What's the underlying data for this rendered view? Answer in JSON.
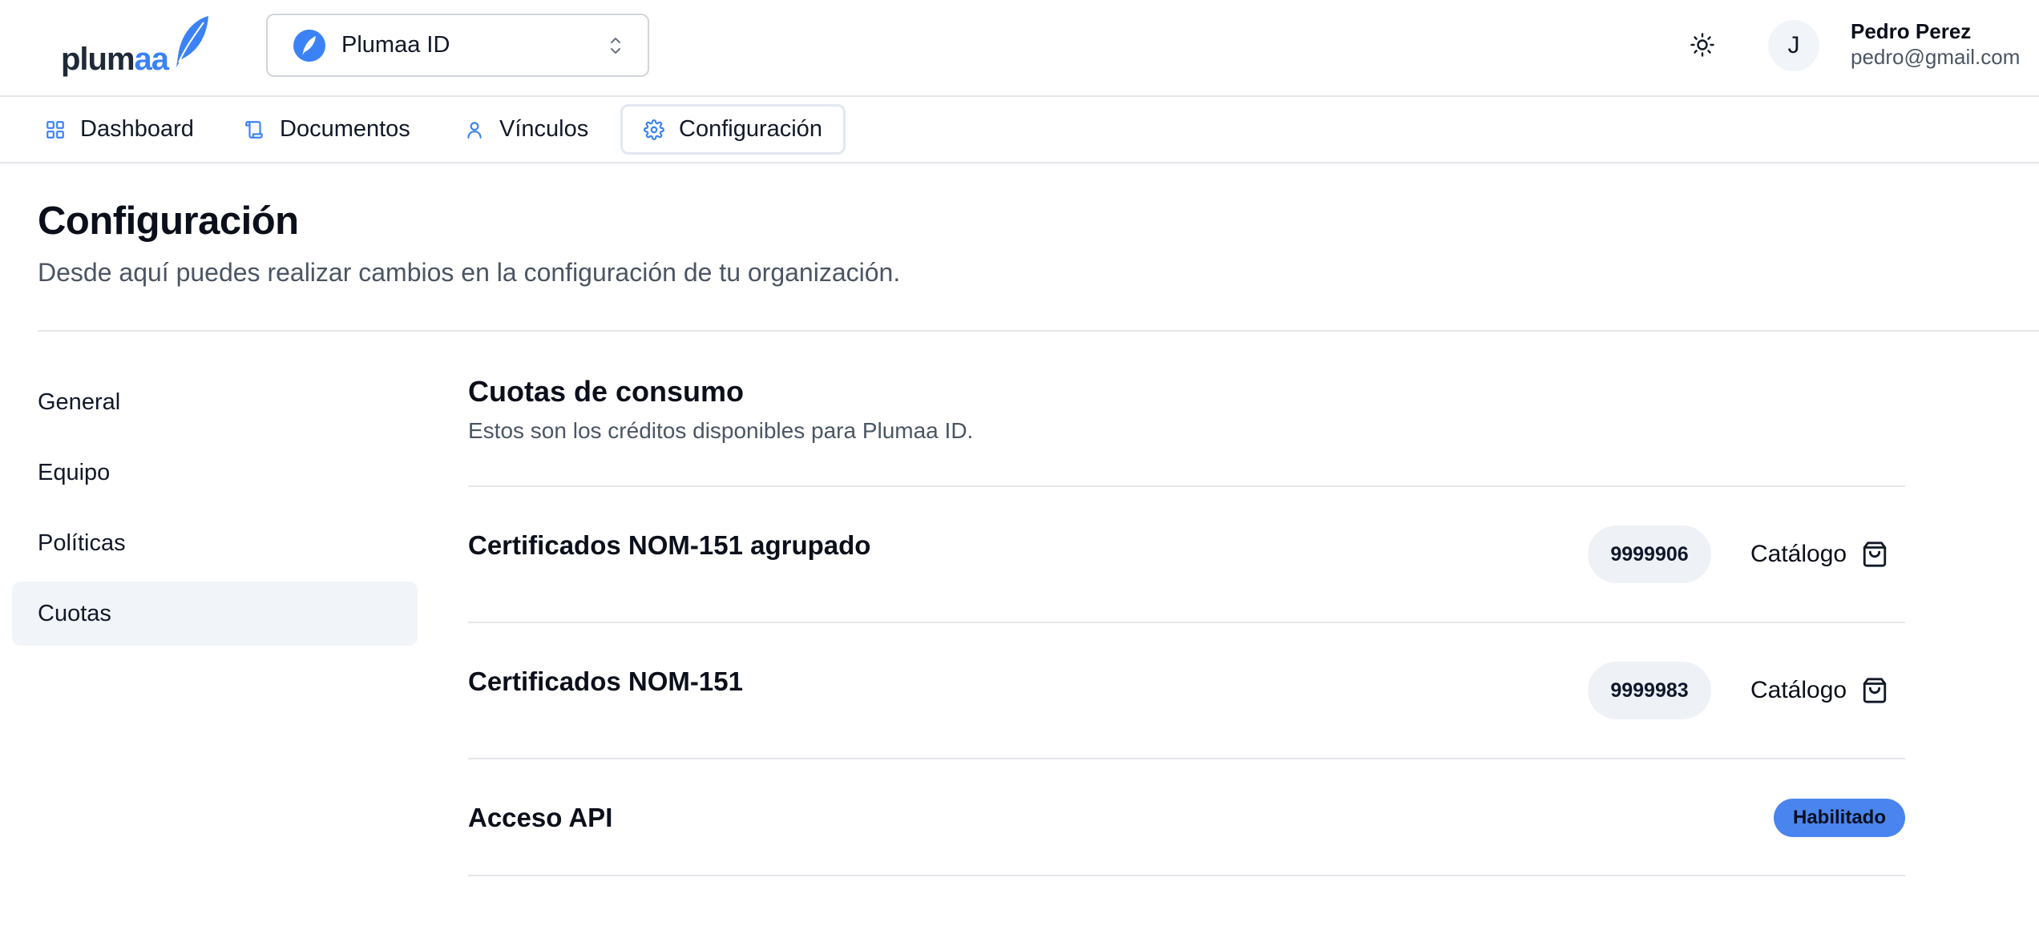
{
  "brand": {
    "logo_text_main": "plum",
    "logo_text_accent": "aa",
    "accent_color": "#3b82f6"
  },
  "header": {
    "org_selector": {
      "selected": "Plumaa ID"
    },
    "theme_toggle_icon": "sun-icon",
    "user": {
      "avatar_initial": "J",
      "name": "Pedro Perez",
      "email": "pedro@gmail.com"
    }
  },
  "nav": {
    "items": [
      {
        "label": "Dashboard",
        "icon": "grid-icon"
      },
      {
        "label": "Documentos",
        "icon": "scroll-icon"
      },
      {
        "label": "Vínculos",
        "icon": "user-icon"
      },
      {
        "label": "Configuración",
        "icon": "gear-icon",
        "active": true
      }
    ]
  },
  "page": {
    "title": "Configuración",
    "subtitle": "Desde aquí puedes realizar cambios en la configuración de tu organización."
  },
  "settings_menu": {
    "items": [
      {
        "label": "General"
      },
      {
        "label": "Equipo"
      },
      {
        "label": "Políticas"
      },
      {
        "label": "Cuotas",
        "active": true
      }
    ]
  },
  "quotas": {
    "title": "Cuotas de consumo",
    "subtitle": "Estos son los créditos disponibles para Plumaa ID.",
    "rows": [
      {
        "label": "Certificados NOM-151 agrupado",
        "count": "9999906",
        "action": "Catálogo",
        "action_icon": "shopping-bag-icon"
      },
      {
        "label": "Certificados NOM-151",
        "count": "9999983",
        "action": "Catálogo",
        "action_icon": "shopping-bag-icon"
      },
      {
        "label": "Acceso API",
        "status": "Habilitado",
        "status_color": "#4a84ee"
      }
    ]
  }
}
